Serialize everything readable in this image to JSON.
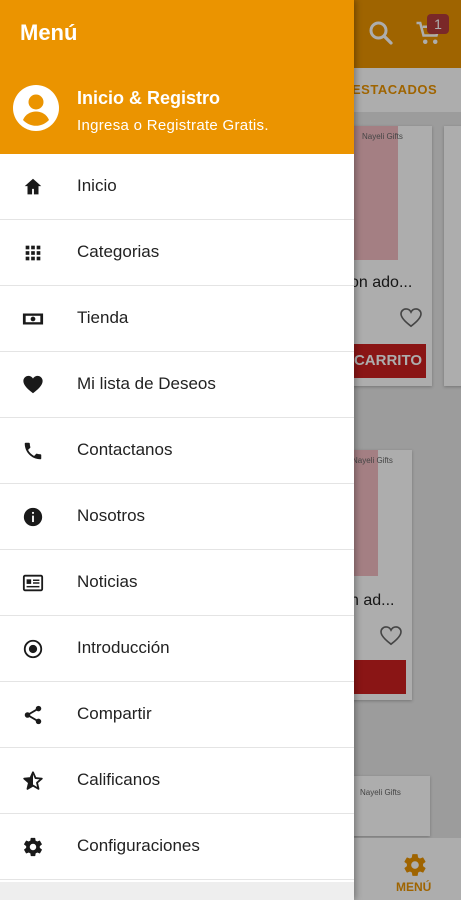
{
  "background": {
    "cart_badge": "1",
    "tab_label": "ESTACADOS",
    "cards": [
      {
        "title": "on ado...",
        "cart_label": "CARRITO",
        "brand": "Nayeli Gifts"
      },
      {
        "title": "n ad...",
        "brand": "Nayeli Gifts"
      },
      {
        "brand": "Nayeli Gifts"
      }
    ],
    "bottom_nav_label": "MENÚ"
  },
  "drawer": {
    "title": "Menú",
    "header": {
      "title": "Inicio & Registro",
      "subtitle": "Ingresa o Registrate Gratis."
    },
    "items": [
      {
        "label": "Inicio",
        "icon": "home-icon"
      },
      {
        "label": "Categorias",
        "icon": "grid-icon"
      },
      {
        "label": "Tienda",
        "icon": "money-icon"
      },
      {
        "label": "Mi lista de Deseos",
        "icon": "heart-icon"
      },
      {
        "label": "Contactanos",
        "icon": "phone-icon"
      },
      {
        "label": "Nosotros",
        "icon": "info-icon"
      },
      {
        "label": "Noticias",
        "icon": "newspaper-icon"
      },
      {
        "label": "Introducción",
        "icon": "radio-icon"
      },
      {
        "label": "Compartir",
        "icon": "share-icon"
      },
      {
        "label": "Calificanos",
        "icon": "star-icon"
      },
      {
        "label": "Configuraciones",
        "icon": "gear-icon"
      }
    ]
  },
  "colors": {
    "accent": "#eb9400",
    "cart_button": "#cc1f1f"
  }
}
